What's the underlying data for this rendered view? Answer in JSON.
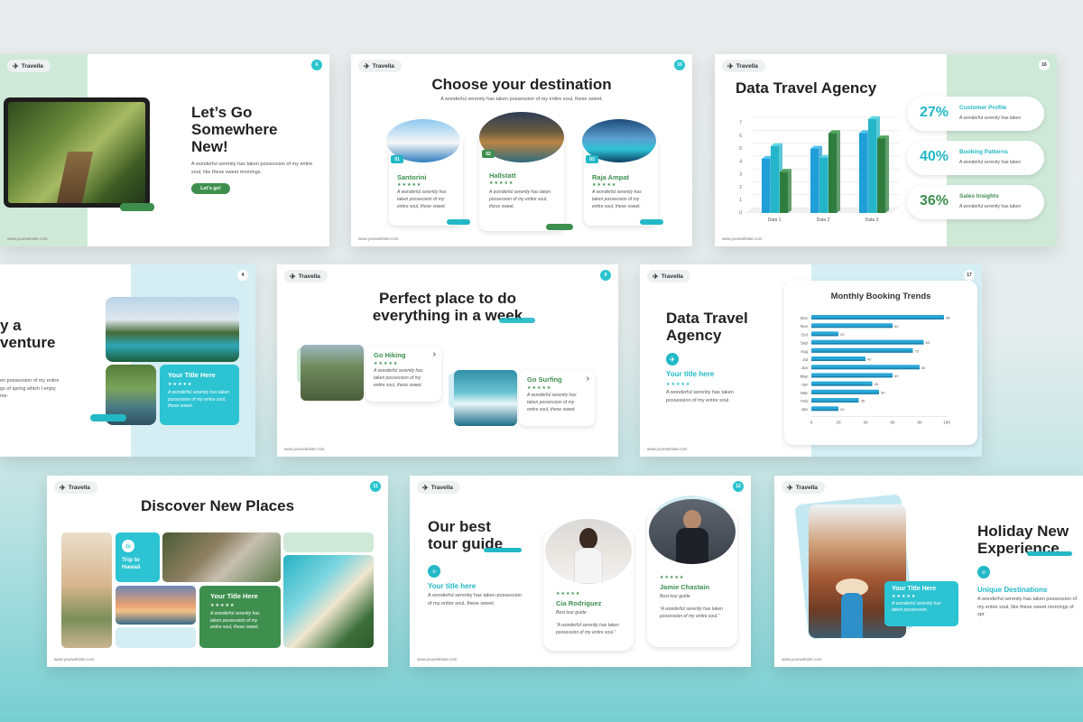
{
  "brand": "Travella",
  "footer": "www.yourwebsite.com",
  "slides": {
    "s1": {
      "num": "6",
      "title": "Let’s Go Somewhere New!",
      "body": "A wonderful serenity has taken possession of my entire soul, like these sweet mornings.",
      "button": "Let’s go!"
    },
    "s2": {
      "num": "10",
      "title": "Choose your destination",
      "subtitle": "A wonderful serenity has taken possession of my entire soul, these sweet.",
      "cards": [
        {
          "no": "01",
          "name": "Santorini",
          "stars": "★★★★★",
          "text": "A wonderful serenity has taken possession of my entire soul, these sweet."
        },
        {
          "no": "02",
          "name": "Hallstatt",
          "stars": "★★★★★",
          "text": "A wonderful serenity has taken possession of my entire soul, these sweet."
        },
        {
          "no": "03",
          "name": "Raja Ampat",
          "stars": "★★★★★",
          "text": "A wonderful serenity has taken possession of my entire soul, these sweet."
        }
      ]
    },
    "s3": {
      "num": "16",
      "title": "Data Travel Agency",
      "stats": [
        {
          "pct": "27%",
          "label": "Customer Profile",
          "text": "A wonderful serenity has taken"
        },
        {
          "pct": "40%",
          "label": "Booking Patterns",
          "text": "A wonderful serenity has taken"
        },
        {
          "pct": "36%",
          "label": "Sales Insights",
          "text": "A wonderful serenity has taken"
        }
      ]
    },
    "s4": {
      "num": "4",
      "title_line1": "y a",
      "title_line2": "venture",
      "body": "en possession of my entire gs of spring which I enjoy me.",
      "card_title": "Your Title Here",
      "card_stars": "★★★★★",
      "card_text": "A wonderful serenity has taken possession of my entire soul, these sweet."
    },
    "s5": {
      "num": "9",
      "title_line1": "Perfect place to do",
      "title_line2": "everything in a week",
      "items": [
        {
          "name": "Go Hiking",
          "stars": "★★★★★",
          "text": "A wonderful serenity has taken possession of my entire soul, these sweet.",
          "arrow": "›"
        },
        {
          "name": "Go Surfing",
          "stars": "★★★★★",
          "text": "A wonderful serenity has taken possession of my entire soul, these sweet.",
          "arrow": "›"
        }
      ]
    },
    "s6": {
      "num": "17",
      "title_line1": "Data Travel",
      "title_line2": "Agency",
      "sub": "Your title here",
      "stars": "★★★★★",
      "body": "A wonderful serenity has taken possession of my entire soul."
    },
    "s7": {
      "num": "11",
      "title": "Discover New Places",
      "tile_text": "Trip to Hawaii",
      "card_title": "Your Title Here",
      "card_stars": "★★★★★",
      "card_text": "A wonderful serenity has taken possession of my entire soul, these sweet."
    },
    "s8": {
      "num": "12",
      "title_line1": "Our best",
      "title_line2": "tour guide",
      "sub": "Your title here",
      "body": "A wonderful serenity has taken possession of my entire soul, these sweet.",
      "guides": [
        {
          "stars": "★★★★★",
          "name": "Cia Rodriguez",
          "role": "Best tour guide",
          "quote": "“A wonderful serenity has taken possession of my entire soul.”"
        },
        {
          "stars": "★★★★★",
          "name": "Jamie Chastain",
          "role": "Best tour guide",
          "quote": "“A wonderful serenity has taken possession of my entire soul.”"
        }
      ]
    },
    "s9": {
      "title_line1": "Holiday New",
      "title_line2": "Experience",
      "card_title": "Your Title Here",
      "card_stars": "★★★★★",
      "card_text": "A wonderful serenity has taken possession.",
      "sub": "Unique Destinations",
      "body": "A wonderful serenity has taken possession of my entire soul, like these sweet mornings of spr"
    }
  },
  "colors": {
    "teal": "#22b8c6",
    "green": "#3e8f4e",
    "mint": "#cfe9d8",
    "lightblue": "#d4eef4"
  },
  "chart_data": [
    {
      "type": "bar",
      "categories": [
        "Data 1",
        "Data 2",
        "Data 3"
      ],
      "series": [
        {
          "values": [
            4.2,
            5,
            6.2
          ]
        },
        {
          "values": [
            5.2,
            4.3,
            7.3
          ]
        },
        {
          "values": [
            3.2,
            6.2,
            5.8
          ]
        }
      ],
      "yticks": [
        "0",
        "1",
        "2",
        "3",
        "4",
        "5",
        "6",
        "7"
      ],
      "ylim": [
        0,
        7
      ]
    },
    {
      "type": "bar",
      "orientation": "horizontal",
      "title": "Monthly Booking Trends",
      "categories": [
        "Jan",
        "Feb",
        "Mar",
        "Apr",
        "May",
        "Jun",
        "Jul",
        "Aug",
        "Sep",
        "Oct",
        "Nov",
        "Dec"
      ],
      "values": [
        20,
        35,
        50,
        45,
        60,
        80,
        40,
        75,
        83,
        20,
        60,
        98
      ],
      "xticks": [
        "0",
        "20",
        "40",
        "60",
        "80",
        "100"
      ],
      "xlim": [
        0,
        100
      ]
    }
  ]
}
